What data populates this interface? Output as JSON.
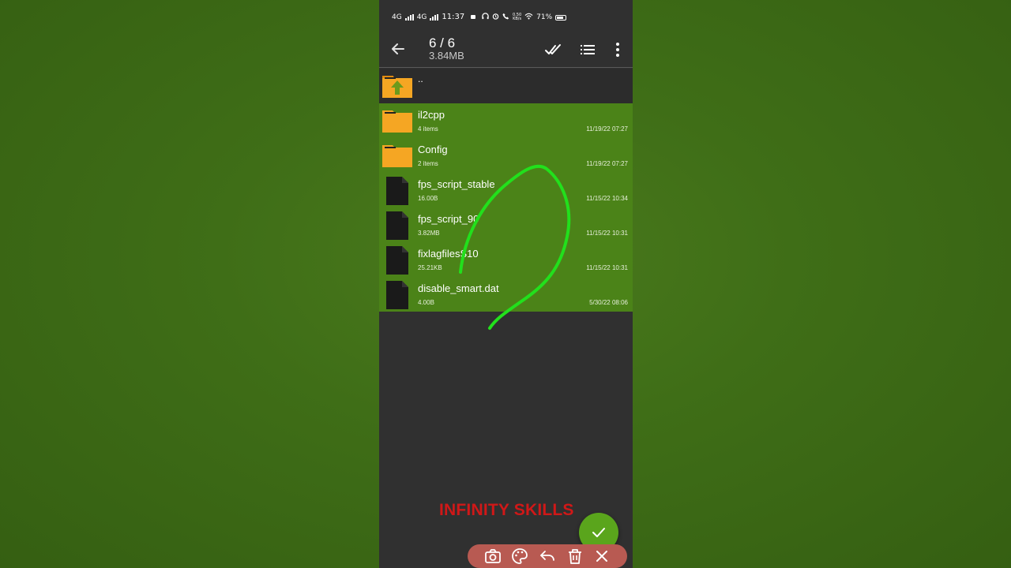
{
  "status_bar": {
    "network_1": "4G",
    "network_2": "4G",
    "time": "11:37",
    "data_speed": "0.50\nKB/s",
    "battery": "71%"
  },
  "toolbar": {
    "selection_count": "6 / 6",
    "selection_size": "3.84MB",
    "icons": [
      "back-arrow-icon",
      "select-all-icon",
      "list-view-icon",
      "more-vert-icon"
    ]
  },
  "parent_entry": {
    "label": ".."
  },
  "files": [
    {
      "name": "il2cpp",
      "meta": "4 items",
      "date": "11/19/22 07:27",
      "type": "folder"
    },
    {
      "name": "Config",
      "meta": "2 items",
      "date": "11/19/22 07:27",
      "type": "folder"
    },
    {
      "name": "fps_script_stable",
      "meta": "16.00B",
      "date": "11/15/22 10:34",
      "type": "file"
    },
    {
      "name": "fps_script_90",
      "meta": "3.82MB",
      "date": "11/15/22 10:31",
      "type": "file"
    },
    {
      "name": "fixlagfilesS10",
      "meta": "25.21KB",
      "date": "11/15/22 10:31",
      "type": "file"
    },
    {
      "name": "disable_smart.dat",
      "meta": "4.00B",
      "date": "5/30/22 08:06",
      "type": "file"
    }
  ],
  "watermark": "INFINITY SKILLS",
  "fab": {
    "icon": "check-icon"
  },
  "annotation_bar": {
    "icons": [
      "camera-icon",
      "palette-icon",
      "undo-icon",
      "trash-icon",
      "close-icon"
    ]
  },
  "colors": {
    "background": "#3f6e17",
    "phone_bg": "#303030",
    "selected_row": "#4b8318",
    "folder": "#f5a623",
    "doodle": "#22e01c",
    "watermark": "#d01818",
    "fab": "#5aa51c"
  }
}
